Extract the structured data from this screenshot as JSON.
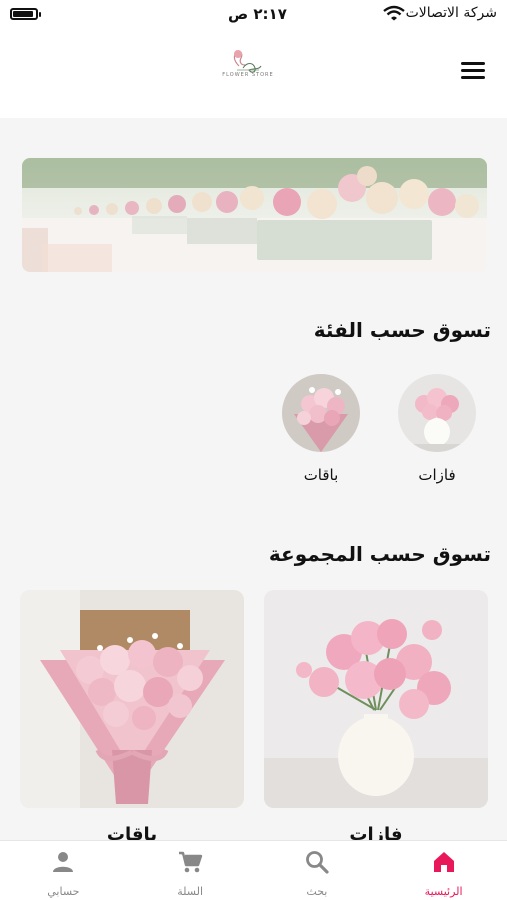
{
  "status_bar": {
    "carrier": "شركة الاتصالات",
    "time": "٢:١٧ ص",
    "battery_level": 0.9
  },
  "header": {
    "logo_text": "FLOWER STORE",
    "menu_icon": "hamburger-menu-icon"
  },
  "categories": {
    "title": "تسوق حسب الفئة",
    "items": [
      {
        "label": "فازات"
      },
      {
        "label": "باقات"
      }
    ]
  },
  "collections": {
    "title": "تسوق حسب المجموعة",
    "items": [
      {
        "label": "فازات"
      },
      {
        "label": "باقات"
      }
    ]
  },
  "bottom_nav": {
    "items": [
      {
        "label": "الرئيسية",
        "icon": "home-icon",
        "active": true
      },
      {
        "label": "بحث",
        "icon": "search-icon",
        "active": false
      },
      {
        "label": "السلة",
        "icon": "cart-icon",
        "active": false
      },
      {
        "label": "حسابي",
        "icon": "person-icon",
        "active": false
      }
    ]
  },
  "colors": {
    "accent": "#e8185a",
    "background": "#f5f5f5"
  }
}
